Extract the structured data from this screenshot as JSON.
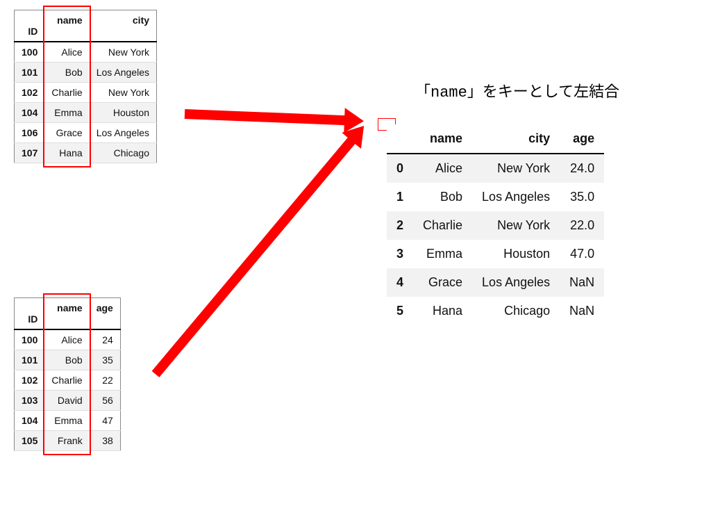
{
  "caption_parts": {
    "prefix": "「",
    "key": "name",
    "suffix": "」をキーとして左結合"
  },
  "table1": {
    "headers": {
      "idx": "ID",
      "name": "name",
      "city": "city"
    },
    "rows": [
      {
        "id": "100",
        "name": "Alice",
        "city": "New York"
      },
      {
        "id": "101",
        "name": "Bob",
        "city": "Los Angeles"
      },
      {
        "id": "102",
        "name": "Charlie",
        "city": "New York"
      },
      {
        "id": "104",
        "name": "Emma",
        "city": "Houston"
      },
      {
        "id": "106",
        "name": "Grace",
        "city": "Los Angeles"
      },
      {
        "id": "107",
        "name": "Hana",
        "city": "Chicago"
      }
    ]
  },
  "table2": {
    "headers": {
      "idx": "ID",
      "name": "name",
      "age": "age"
    },
    "rows": [
      {
        "id": "100",
        "name": "Alice",
        "age": "24"
      },
      {
        "id": "101",
        "name": "Bob",
        "age": "35"
      },
      {
        "id": "102",
        "name": "Charlie",
        "age": "22"
      },
      {
        "id": "103",
        "name": "David",
        "age": "56"
      },
      {
        "id": "104",
        "name": "Emma",
        "age": "47"
      },
      {
        "id": "105",
        "name": "Frank",
        "age": "38"
      }
    ]
  },
  "result": {
    "headers": {
      "name": "name",
      "city": "city",
      "age": "age"
    },
    "rows": [
      {
        "idx": "0",
        "name": "Alice",
        "city": "New York",
        "age": "24.0"
      },
      {
        "idx": "1",
        "name": "Bob",
        "city": "Los Angeles",
        "age": "35.0"
      },
      {
        "idx": "2",
        "name": "Charlie",
        "city": "New York",
        "age": "22.0"
      },
      {
        "idx": "3",
        "name": "Emma",
        "city": "Houston",
        "age": "47.0"
      },
      {
        "idx": "4",
        "name": "Grace",
        "city": "Los Angeles",
        "age": "NaN"
      },
      {
        "idx": "5",
        "name": "Hana",
        "city": "Chicago",
        "age": "NaN"
      }
    ]
  }
}
